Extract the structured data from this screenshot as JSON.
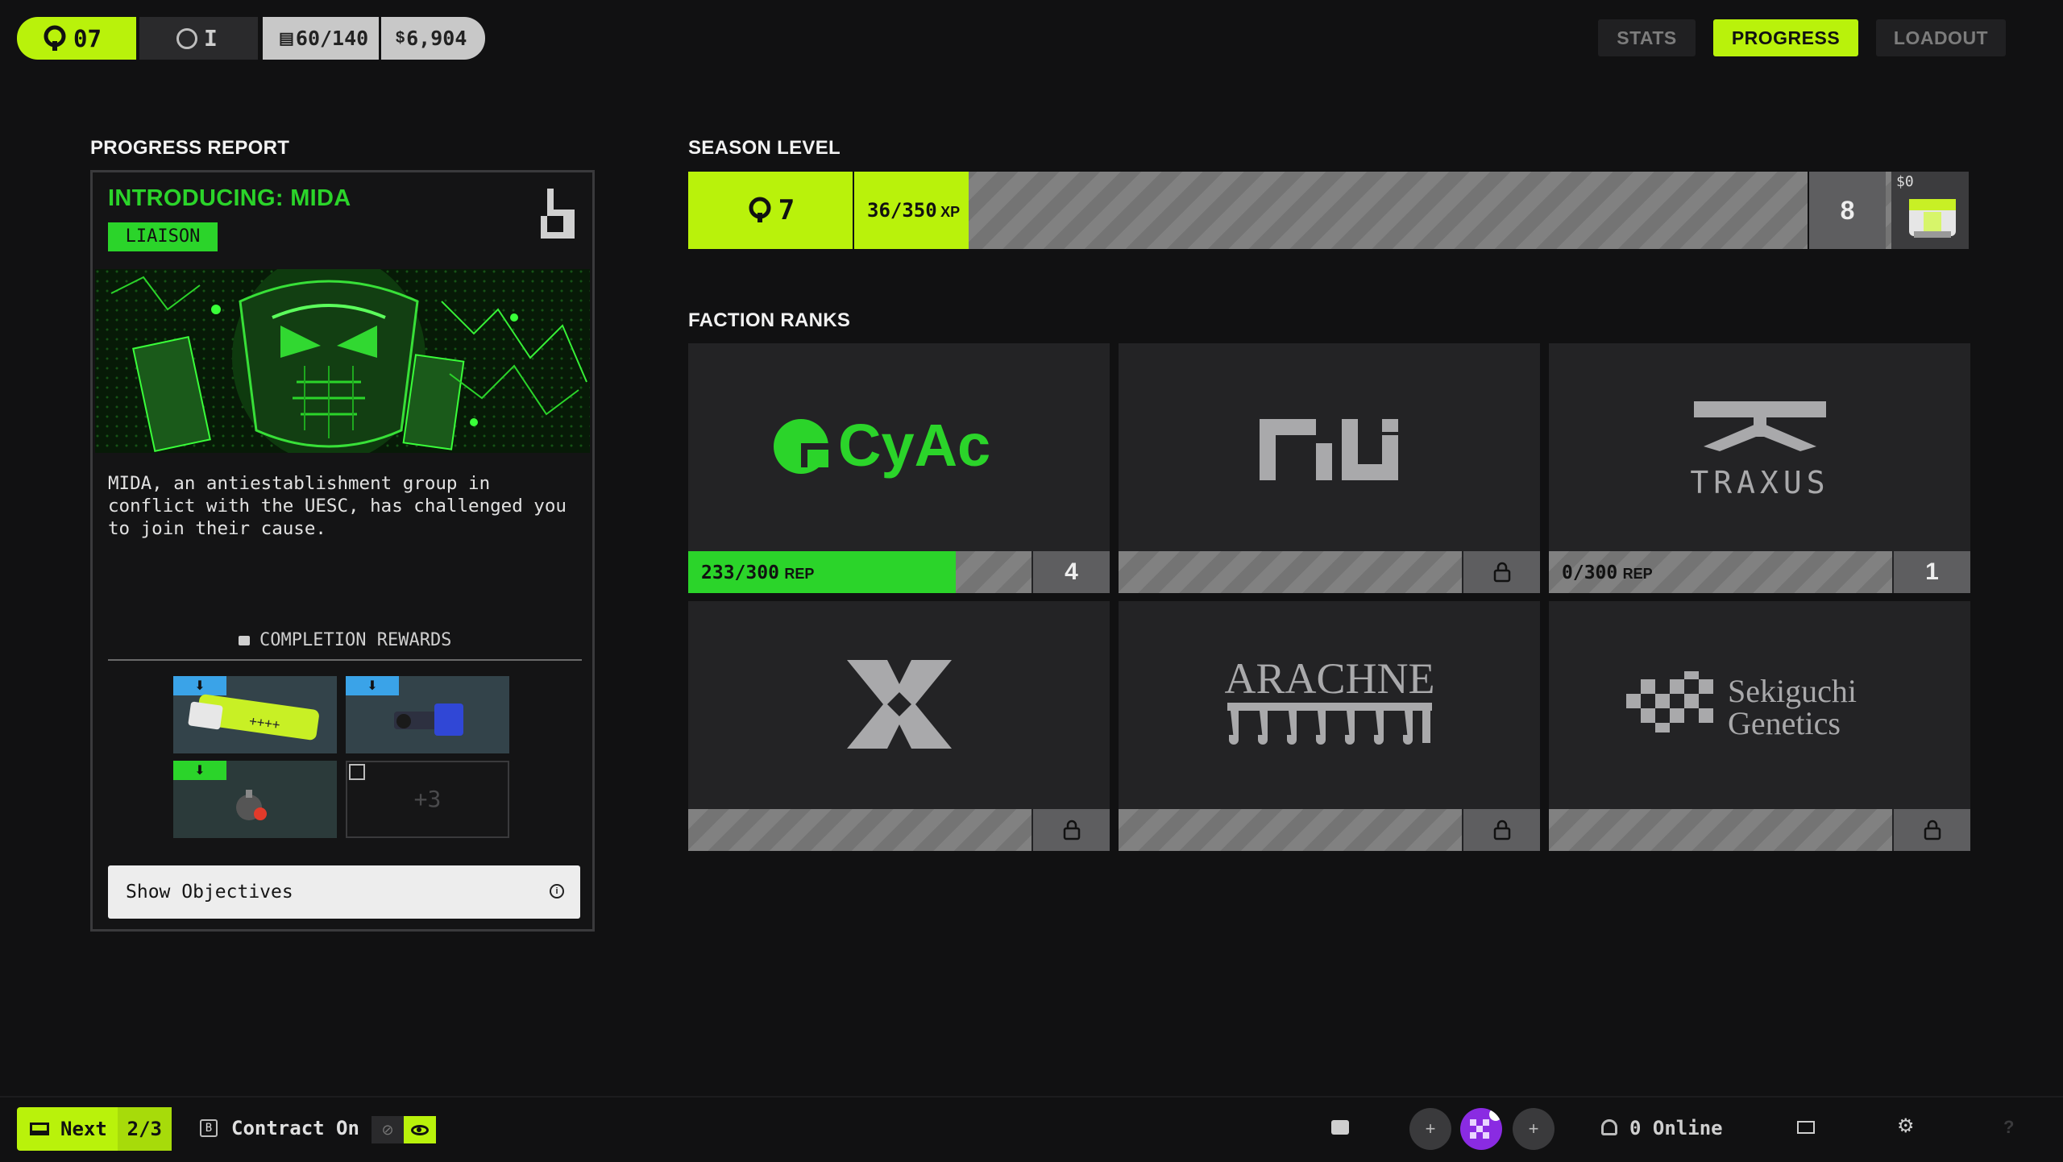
{
  "topbar": {
    "rank_value": "07",
    "secondary_rank": "I",
    "inventory": "60/140",
    "credits": "6,904",
    "tabs": [
      {
        "label": "STATS",
        "active": false
      },
      {
        "label": "PROGRESS",
        "active": true
      },
      {
        "label": "LOADOUT",
        "active": false
      }
    ]
  },
  "progress_report": {
    "section_title": "PROGRESS REPORT",
    "card_title": "INTRODUCING: MIDA",
    "badge": "LIAISON",
    "description": "MIDA, an antiestablishment group in conflict with the UESC, has challenged you to join their cause.",
    "rewards_title": "COMPLETION REWARDS",
    "rewards": [
      {
        "item": "green-tech-canister"
      },
      {
        "item": "blue-weapon-part"
      },
      {
        "item": "grenade-item"
      },
      {
        "item": "more",
        "label": "+3"
      }
    ],
    "objectives_button": "Show Objectives"
  },
  "season_level": {
    "section_title": "SEASON LEVEL",
    "current_level": "7",
    "xp_text": "36/350",
    "xp_unit": "XP",
    "xp_progress": 0.1029,
    "next_level": "8",
    "reward_count": "0"
  },
  "faction_ranks": {
    "section_title": "FACTION RANKS",
    "factions": [
      {
        "name": "CyAc",
        "rep_text": "233/300",
        "rep_unit": "REP",
        "rep_progress": 0.7767,
        "level": "4",
        "locked": false,
        "accent": "#2bd42a"
      },
      {
        "name": "NuCaloric",
        "locked": true
      },
      {
        "name": "TRAXUS",
        "rep_text": "0/300",
        "rep_unit": "REP",
        "rep_progress": 0,
        "level": "1",
        "locked": false
      },
      {
        "name": "MIDA",
        "locked": true
      },
      {
        "name": "ARACHNE",
        "locked": true
      },
      {
        "name": "Sekiguchi Genetics",
        "name_line1": "Sekiguchi",
        "name_line2": "Genetics",
        "locked": true
      }
    ]
  },
  "bottombar": {
    "next_label": "Next",
    "next_count": "2/3",
    "contract_key": "B",
    "contract_label": "Contract On",
    "online_text": "0 Online"
  },
  "colors": {
    "accent_lime": "#b9f20b",
    "accent_green": "#2bd42a",
    "background": "#111112"
  }
}
